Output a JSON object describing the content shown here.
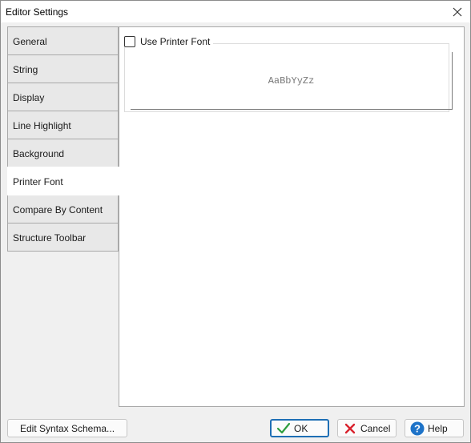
{
  "window": {
    "title": "Editor Settings"
  },
  "tabs": [
    {
      "label": "General",
      "active": false
    },
    {
      "label": "String",
      "active": false
    },
    {
      "label": "Display",
      "active": false
    },
    {
      "label": "Line Highlight",
      "active": false
    },
    {
      "label": "Background",
      "active": false
    },
    {
      "label": "Printer Font",
      "active": true
    },
    {
      "label": "Compare By Content",
      "active": false
    },
    {
      "label": "Structure Toolbar",
      "active": false
    }
  ],
  "printer_font": {
    "use_printer_font_label": "Use Printer Font",
    "use_printer_font_checked": false,
    "preview_text": "AaBbYyZz"
  },
  "footer": {
    "edit_syntax_label": "Edit Syntax Schema...",
    "ok_label": "OK",
    "cancel_label": "Cancel",
    "help_label": "Help"
  },
  "colors": {
    "accent": "#1f6fb5",
    "ok_check": "#2e9e3e",
    "cancel_x": "#d9232e",
    "help_circle": "#1e73c8"
  }
}
